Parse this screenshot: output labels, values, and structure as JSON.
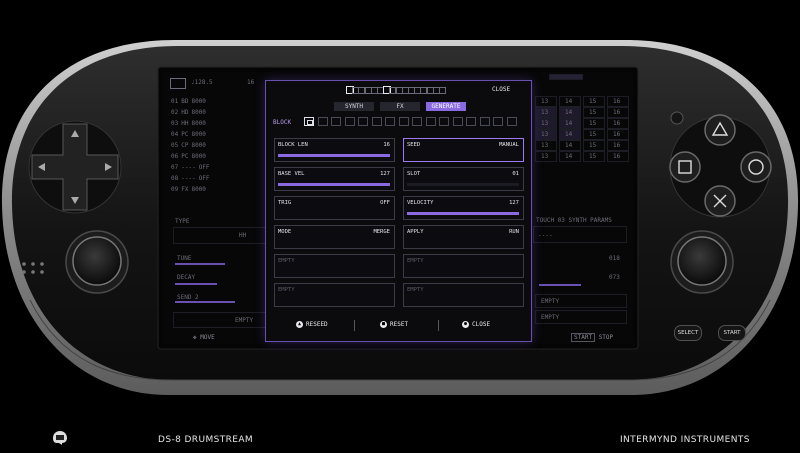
{
  "footer": {
    "left_title": "DS-8 DRUMSTREAM",
    "right_title": "INTERMYND INSTRUMENTS"
  },
  "device": {
    "select_label": "SELECT",
    "start_label": "START"
  },
  "background": {
    "bpm": "♩128.5",
    "channel": "16",
    "tracks": [
      {
        "id": "01",
        "name": "BD",
        "pattern": "8000"
      },
      {
        "id": "02",
        "name": "HD",
        "pattern": "8000"
      },
      {
        "id": "03",
        "name": "HH",
        "pattern": "8000"
      },
      {
        "id": "04",
        "name": "PC",
        "pattern": "8000"
      },
      {
        "id": "05",
        "name": "CP",
        "pattern": "8000"
      },
      {
        "id": "06",
        "name": "PC",
        "pattern": "8000"
      },
      {
        "id": "07",
        "name": "----",
        "pattern": "OFF"
      },
      {
        "id": "08",
        "name": "----",
        "pattern": "OFF"
      },
      {
        "id": "09",
        "name": "FX",
        "pattern": "8000"
      }
    ],
    "step_headers": [
      "13",
      "14",
      "15",
      "16"
    ],
    "type_label": "TYPE",
    "type_value": "HH",
    "tune_label": "TUNE",
    "tune_value": "018",
    "decay_label": "DECAY",
    "decay_value": "073",
    "send_label": "SEND 2",
    "empty_label": "EMPTY",
    "touch_label": "TOUCH 03  SYNTH PARAMS",
    "touch_value": "----",
    "move_label": "MOVE",
    "start_label": "START",
    "stop_label": "STOP"
  },
  "dialog": {
    "close_label": "CLOSE",
    "pager": {
      "count": 16,
      "active": [
        0,
        6
      ]
    },
    "tabs": [
      {
        "label": "SYNTH",
        "active": false
      },
      {
        "label": "FX",
        "active": false
      },
      {
        "label": "GENERATE",
        "active": true
      }
    ],
    "block_label": "BLOCK",
    "block_count": 16,
    "block_selected": "1",
    "params": [
      {
        "name": "BLOCK LEN",
        "value": "16",
        "fill": 1.0,
        "selected": false
      },
      {
        "name": "SEED",
        "value": "MANUAL",
        "fill": null,
        "selected": true
      },
      {
        "name": "BASE VEL",
        "value": "127",
        "fill": 1.0,
        "selected": false
      },
      {
        "name": "SLOT",
        "value": "01",
        "fill": 0.0,
        "selected": false
      },
      {
        "name": "TRIG",
        "value": "OFF",
        "fill": null,
        "selected": false
      },
      {
        "name": "VELOCITY",
        "value": "127",
        "fill": 1.0,
        "selected": false
      },
      {
        "name": "MODE",
        "value": "MERGE",
        "fill": null,
        "selected": false
      },
      {
        "name": "APPLY",
        "value": "RUN",
        "fill": null,
        "selected": false
      },
      {
        "name": "EMPTY",
        "value": "",
        "fill": null,
        "selected": false
      },
      {
        "name": "EMPTY",
        "value": "",
        "fill": null,
        "selected": false
      },
      {
        "name": "EMPTY",
        "value": "",
        "fill": null,
        "selected": false
      },
      {
        "name": "EMPTY",
        "value": "",
        "fill": null,
        "selected": false
      }
    ],
    "footer_buttons": [
      {
        "icon": "triangle-icon",
        "label": "RESEED"
      },
      {
        "icon": "square-icon",
        "label": "RESET"
      },
      {
        "icon": "circle-icon",
        "label": "CLOSE"
      }
    ]
  },
  "colors": {
    "accent": "#8a6ae0",
    "accent_light": "#b89cf0",
    "body": "#1a1a1a",
    "trim": "#9a9a9a"
  }
}
